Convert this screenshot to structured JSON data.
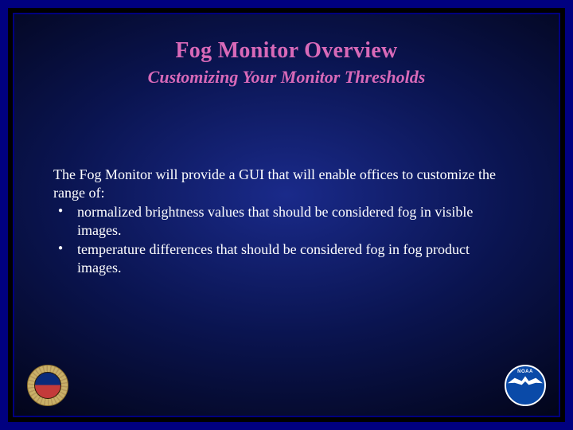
{
  "title": "Fog Monitor Overview",
  "subtitle": "Customizing Your Monitor Thresholds",
  "intro": "The Fog Monitor will provide a GUI that will enable offices to customize the range of:",
  "bullets": [
    "normalized brightness values that should be considered fog in visible images.",
    "temperature differences that should be considered fog in fog product images."
  ],
  "logos": {
    "left_name": "nws-seal",
    "right_name": "noaa-logo",
    "noaa_label": "NOAA"
  }
}
